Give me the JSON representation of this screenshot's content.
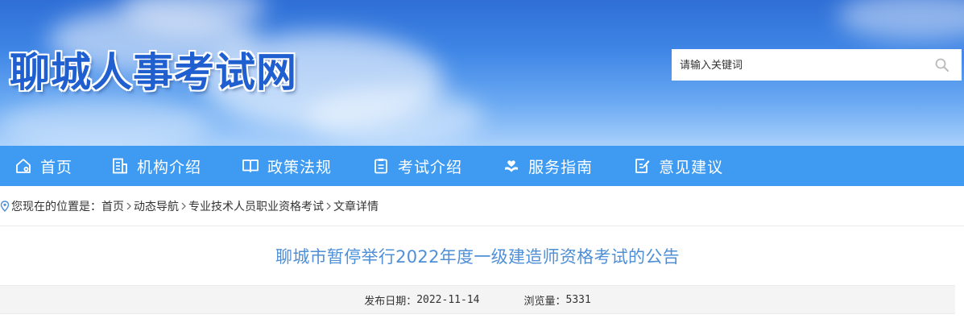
{
  "header": {
    "site_title": "聊城人事考试网",
    "search": {
      "placeholder": "请输入关键词",
      "value": ""
    }
  },
  "nav": {
    "items": [
      {
        "label": "首页",
        "icon": "home-icon"
      },
      {
        "label": "机构介绍",
        "icon": "building-icon"
      },
      {
        "label": "政策法规",
        "icon": "book-icon"
      },
      {
        "label": "考试介绍",
        "icon": "clipboard-icon"
      },
      {
        "label": "服务指南",
        "icon": "heart-hand-icon"
      },
      {
        "label": "意见建议",
        "icon": "edit-icon"
      }
    ]
  },
  "breadcrumb": {
    "prefix": "您现在的位置是：",
    "items": [
      "首页",
      "动态导航",
      "专业技术人员职业资格考试",
      "文章详情"
    ]
  },
  "article": {
    "title": "聊城市暂停举行2022年度一级建造师资格考试的公告",
    "publish_label": "发布日期：",
    "publish_date": "2022-11-14",
    "views_label": "浏览量：",
    "views": "5331"
  },
  "colors": {
    "nav_bg": "#3f9bf2",
    "title_blue": "#4f8fd6",
    "logo_blue": "#1f5fcf"
  }
}
